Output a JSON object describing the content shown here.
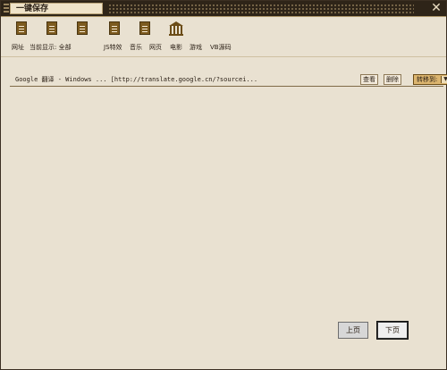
{
  "window": {
    "title": "一键保存",
    "close_icon": "close-icon"
  },
  "toolbar": {
    "icons": [
      "document-icon",
      "document-icon",
      "document-icon",
      "document-icon",
      "documents-icon",
      "bank-icon"
    ],
    "nav": {
      "url": "网址",
      "current_display": "当前显示: 全部",
      "js": "JS特效",
      "music": "音乐",
      "webpage": "网页",
      "movie": "电影",
      "game": "游戏",
      "vb": "VB源码"
    }
  },
  "list": {
    "rows": [
      {
        "text": "Google 翻译 - Windows ... [http://translate.google.cn/?sourcei...",
        "view_label": "查看",
        "delete_label": "删除",
        "move_label": "转移到:"
      }
    ]
  },
  "pager": {
    "prev_label": "上页",
    "next_label": "下页"
  }
}
